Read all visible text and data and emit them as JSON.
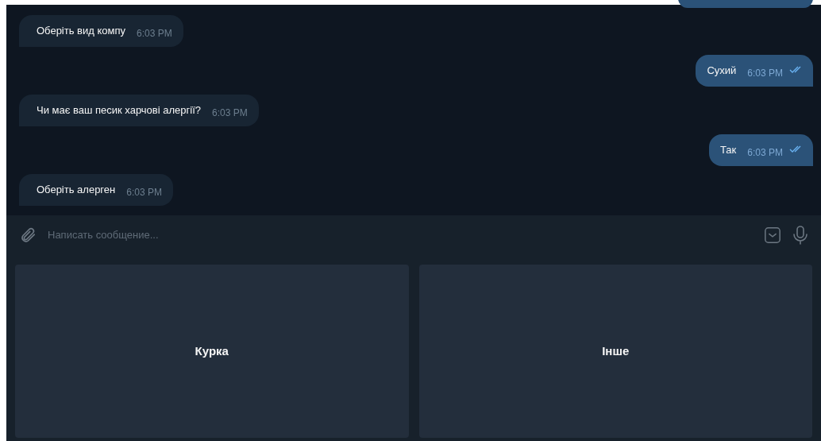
{
  "messages": [
    {
      "kind": "incoming",
      "text": "Оберіть вид компу",
      "time": "6:03 PM"
    },
    {
      "kind": "outgoing",
      "text": "Сухий",
      "time": "6:03 PM",
      "read": true
    },
    {
      "kind": "incoming",
      "text": "Чи має ваш песик харчові алергії?",
      "time": "6:03 PM"
    },
    {
      "kind": "outgoing",
      "text": "Так",
      "time": "6:03 PM",
      "read": true
    },
    {
      "kind": "incoming",
      "text": "Оберіть алерген",
      "time": "6:03 PM"
    }
  ],
  "composer": {
    "placeholder": "Написать сообщение..."
  },
  "keyboard": [
    "Курка",
    "Інше"
  ]
}
